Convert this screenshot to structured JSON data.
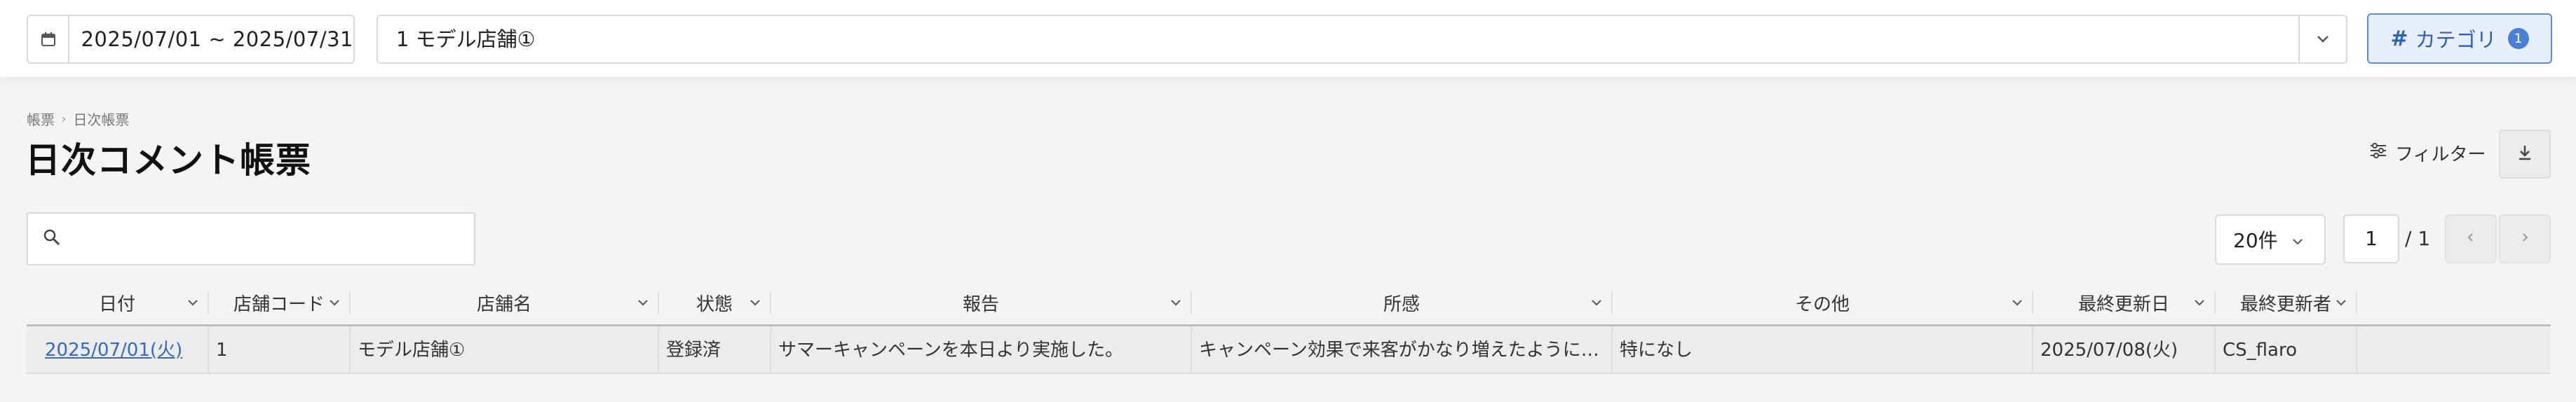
{
  "header": {
    "date_range": "2025/07/01 ~ 2025/07/31",
    "store": "1 モデル店舗①",
    "category_label": "カテゴリ",
    "category_count": "1"
  },
  "breadcrumb": {
    "parent": "帳票",
    "current": "日次帳票"
  },
  "page_title": "日次コメント帳票",
  "toolbar": {
    "filter_label": "フィルター"
  },
  "search": {
    "value": "",
    "placeholder": ""
  },
  "pagination": {
    "per_page": "20件",
    "current_page": "1",
    "total_label": "/ 1"
  },
  "table": {
    "columns": [
      "日付",
      "店舗コード",
      "店舗名",
      "状態",
      "報告",
      "所感",
      "その他",
      "最終更新日",
      "最終更新者"
    ],
    "rows": [
      {
        "date": "2025/07/01(火)",
        "store_code": "1",
        "store_name": "モデル店舗①",
        "status": "登録済",
        "report": "サマーキャンペーンを本日より実施した。",
        "impression": "キャンペーン効果で来客がかなり増えたように感じる。",
        "other": "特になし",
        "updated_at": "2025/07/08(火)",
        "updated_by": "CS_flaro"
      }
    ]
  },
  "colors": {
    "accent": "#2f5fb8",
    "link": "#2f6ac7",
    "badge": "#4a7fd6"
  }
}
